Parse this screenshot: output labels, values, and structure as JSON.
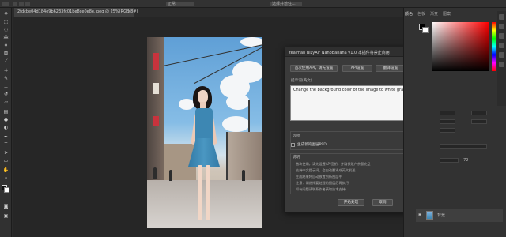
{
  "document": {
    "tab_title": "2fdcbe04d184e9b6233fc01be8ce0e8e.jpeg @ 25%(RGB/8#)",
    "close_glyph": "×"
  },
  "options_bar": {
    "mode_select": "正常",
    "right_button": "选择并遮住..."
  },
  "dialog": {
    "title": "zealman BizyAir NanoBanana v1.0 本插件将禁止商用",
    "buttons": {
      "api_link": "首次使用API，请先设置",
      "api_settings": "API设置",
      "translate_settings": "翻译设置",
      "describe_settings": "描述设置"
    },
    "prompt_label": "提示词(英文)",
    "prompt_text": "Change the background color of the image to white gradually to green",
    "options_label": "选项",
    "checkbox_label": "生成新的图层PSD",
    "notes_label": "说明",
    "notes": [
      "首次使用，请先设置API密钥，并确保账户余额充足",
      "支持中文提示词，会自动翻译成英文发送",
      "生成结果将自动放置到新图层中",
      "注意：请选择要处理的图层后再执行",
      "如有问题请联系作者获取技术支持"
    ],
    "start_button": "开始处理",
    "cancel_button": "取消"
  },
  "right_panel": {
    "tabs": [
      "颜色",
      "色板",
      "渐变",
      "图案"
    ],
    "zoom_value": "72",
    "layer_name": "背景"
  },
  "colors": {
    "photoshop_bg": "#2b2b2b",
    "dialog_bg": "#3a3a3a",
    "prompt_bg": "#f5f5f5"
  }
}
